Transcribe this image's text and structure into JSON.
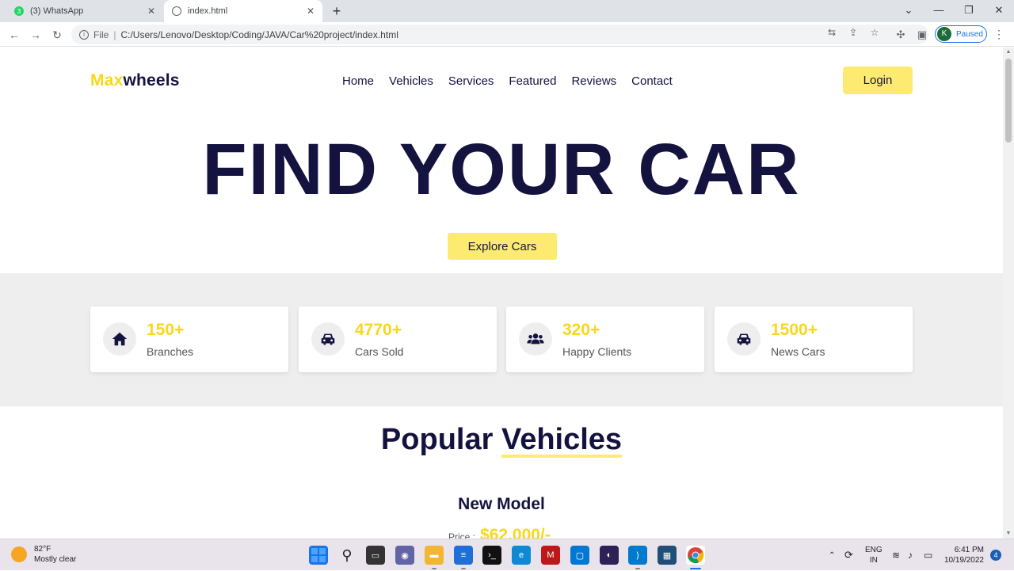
{
  "browser": {
    "tabs": [
      {
        "title": "(3) WhatsApp",
        "badge": "3",
        "active": false
      },
      {
        "title": "index.html",
        "active": true
      }
    ],
    "address": {
      "scheme": "File",
      "url": "C:/Users/Lenovo/Desktop/Coding/JAVA/Car%20project/index.html"
    },
    "profile": {
      "initial": "K",
      "status": "Paused"
    }
  },
  "site": {
    "logo": {
      "accent": "Max",
      "rest": "wheels"
    },
    "nav": [
      "Home",
      "Vehicles",
      "Services",
      "Featured",
      "Reviews",
      "Contact"
    ],
    "login_label": "Login",
    "hero_title": "FIND YOUR CAR",
    "explore_label": "Explore Cars",
    "stats": [
      {
        "icon": "home-icon",
        "value": "150+",
        "label": "Branches"
      },
      {
        "icon": "car-icon",
        "value": "4770+",
        "label": "Cars Sold"
      },
      {
        "icon": "users-icon",
        "value": "320+",
        "label": "Happy Clients"
      },
      {
        "icon": "car-icon",
        "value": "1500+",
        "label": "News Cars"
      }
    ],
    "section_title": {
      "part1": "Popular",
      "part2": "Vehicles"
    },
    "model": {
      "name": "New Model",
      "price_label": "Price :",
      "price_value": "$62,000/-"
    },
    "colors": {
      "primary": "#14123f",
      "accent": "#f9d71c",
      "button": "#fdeb71"
    }
  },
  "taskbar": {
    "weather": {
      "temp": "82°F",
      "desc": "Mostly clear"
    },
    "lang": {
      "line1": "ENG",
      "line2": "IN"
    },
    "clock": {
      "time": "6:41 PM",
      "date": "10/19/2022"
    },
    "notifications": "4"
  }
}
